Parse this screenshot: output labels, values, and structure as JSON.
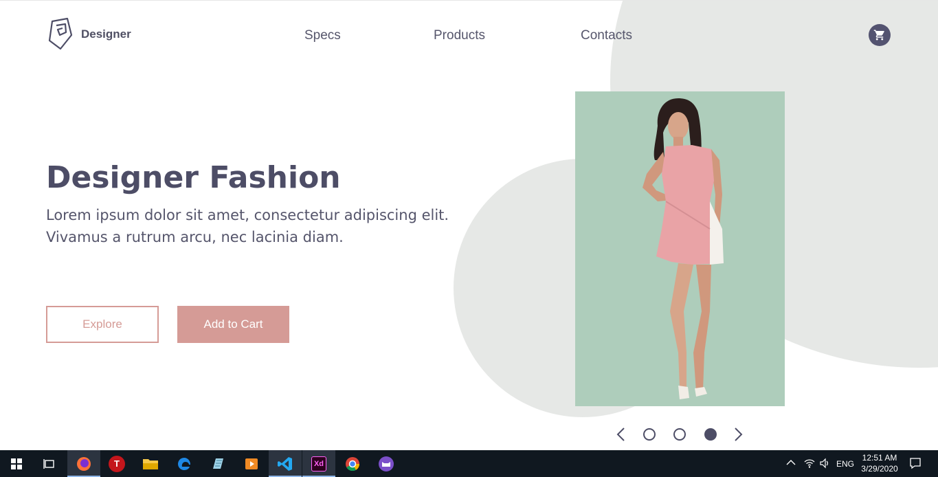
{
  "header": {
    "logo_text": "Designer",
    "nav": [
      "Specs",
      "Products",
      "Contacts"
    ],
    "cart_icon": "shopping-cart-icon"
  },
  "hero": {
    "title": "Designer Fashion",
    "description": "Lorem ipsum dolor sit amet, consectetur adipiscing elit. Vivamus a rutrum arcu, nec lacinia diam.",
    "explore_label": "Explore",
    "add_to_cart_label": "Add to Cart",
    "image": "model-in-pink-dress-photo"
  },
  "slider": {
    "prev_icon": "chevron-left-icon",
    "next_icon": "chevron-right-icon",
    "dots": 3,
    "active_dot": 3
  },
  "colors": {
    "text": "#4d4d66",
    "accent": "#d59b96",
    "blob": "#e6e8e6",
    "photo_bg": "#aecdbb",
    "taskbar": "#101820"
  },
  "taskbar": {
    "apps": [
      "windows-start-icon",
      "task-view-icon",
      "firefox-icon",
      "t-app-icon",
      "file-explorer-icon",
      "edge-icon",
      "notepad-icon",
      "media-player-icon",
      "vscode-icon",
      "adobe-xd-icon",
      "chrome-icon",
      "cat-app-icon"
    ],
    "xd_label": "Xd",
    "t_label": "T",
    "tray": {
      "language": "ENG",
      "time": "12:51 AM",
      "date": "3/29/2020"
    }
  }
}
